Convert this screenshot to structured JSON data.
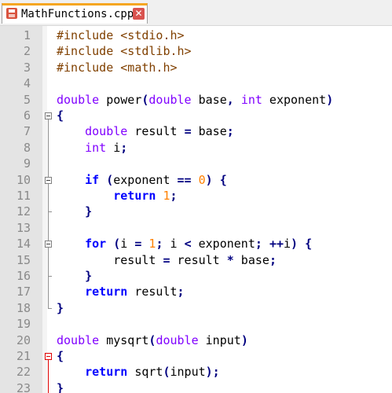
{
  "tab": {
    "title": "MathFunctions.cpp",
    "close_glyph": "✕",
    "icon": "save-disk-icon"
  },
  "editor": {
    "lines": [
      {
        "n": "1",
        "html": "<span class='pp'>#include &lt;stdio.h&gt;</span>"
      },
      {
        "n": "2",
        "html": "<span class='pp'>#include &lt;stdlib.h&gt;</span>"
      },
      {
        "n": "3",
        "html": "<span class='pp'>#include &lt;math.h&gt;</span>"
      },
      {
        "n": "4",
        "html": ""
      },
      {
        "n": "5",
        "html": "<span class='kw'>double</span> power<span class='op'>(</span><span class='kw'>double</span> base<span class='op'>,</span> <span class='kw'>int</span> exponent<span class='op'>)</span>"
      },
      {
        "n": "6",
        "html": "<span class='op'>{</span>"
      },
      {
        "n": "7",
        "html": "    <span class='kw'>double</span> result <span class='op'>=</span> base<span class='op'>;</span>"
      },
      {
        "n": "8",
        "html": "    <span class='kw'>int</span> i<span class='op'>;</span>"
      },
      {
        "n": "9",
        "html": ""
      },
      {
        "n": "10",
        "html": "    <span class='kb'>if</span> <span class='op'>(</span>exponent <span class='op'>==</span> <span class='num'>0</span><span class='op'>)</span> <span class='op'>{</span>"
      },
      {
        "n": "11",
        "html": "        <span class='kb'>return</span> <span class='num'>1</span><span class='op'>;</span>"
      },
      {
        "n": "12",
        "html": "    <span class='op'>}</span>"
      },
      {
        "n": "13",
        "html": ""
      },
      {
        "n": "14",
        "html": "    <span class='kb'>for</span> <span class='op'>(</span>i <span class='op'>=</span> <span class='num'>1</span><span class='op'>;</span> i <span class='op'>&lt;</span> exponent<span class='op'>;</span> <span class='op'>++</span>i<span class='op'>)</span> <span class='op'>{</span>"
      },
      {
        "n": "15",
        "html": "        result <span class='op'>=</span> result <span class='op'>*</span> base<span class='op'>;</span>"
      },
      {
        "n": "16",
        "html": "    <span class='op'>}</span>"
      },
      {
        "n": "17",
        "html": "    <span class='kb'>return</span> result<span class='op'>;</span>"
      },
      {
        "n": "18",
        "html": "<span class='op'>}</span>"
      },
      {
        "n": "19",
        "html": ""
      },
      {
        "n": "20",
        "html": "<span class='kw'>double</span> mysqrt<span class='op'>(</span><span class='kw'>double</span> input<span class='op'>)</span>"
      },
      {
        "n": "21",
        "html": "<span class='op'>{</span>"
      },
      {
        "n": "22",
        "html": "    <span class='kb'>return</span> sqrt<span class='op'>(</span>input<span class='op'>);</span>"
      },
      {
        "n": "23",
        "html": "<span class='op'>}</span>"
      }
    ]
  },
  "colors": {
    "keyword_type": "#8000ff",
    "keyword_instruction": "#0000ff",
    "preprocessor": "#804000",
    "number": "#ff8000",
    "operator": "#000080",
    "line_number": "#8a8a8a",
    "gutter_bg": "#e4e4e4",
    "tab_accent": "#f5a622",
    "active_fold": "#e00000"
  }
}
